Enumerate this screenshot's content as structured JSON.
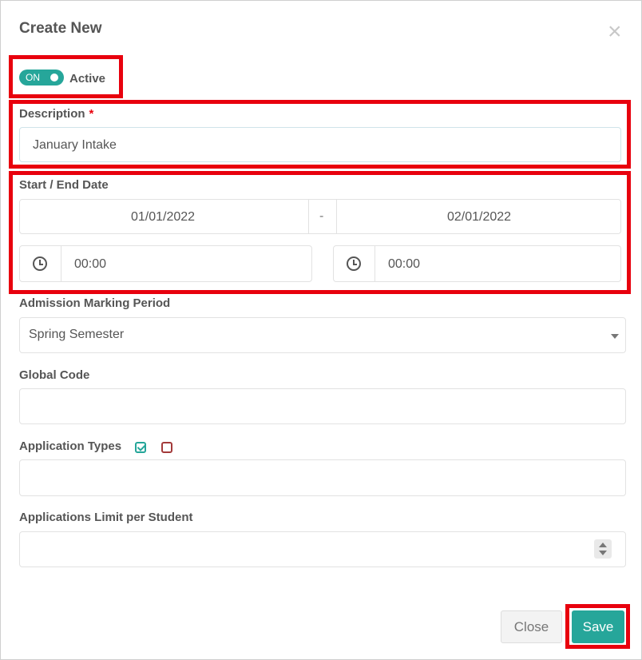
{
  "modal": {
    "title": "Create New",
    "close_icon": "close-icon"
  },
  "status": {
    "toggle_text": "ON",
    "label": "Active"
  },
  "description": {
    "label": "Description",
    "required_mark": "*",
    "value": "January Intake"
  },
  "dates": {
    "label": "Start / End Date",
    "start_date": "01/01/2022",
    "separator": "-",
    "end_date": "02/01/2022",
    "start_time": "00:00",
    "end_time": "00:00",
    "time_icon": "clock-icon"
  },
  "marking_period": {
    "label": "Admission Marking Period",
    "selected": "Spring Semester"
  },
  "global_code": {
    "label": "Global Code",
    "value": ""
  },
  "application_types": {
    "label": "Application Types",
    "select_all_icon": "check-square-icon",
    "deselect_all_icon": "square-icon",
    "value": ""
  },
  "applications_limit": {
    "label": "Applications Limit per Student",
    "value": ""
  },
  "footer": {
    "close_label": "Close",
    "save_label": "Save"
  },
  "colors": {
    "accent": "#26a69a",
    "highlight": "#e8000d",
    "required": "#e8000d"
  }
}
